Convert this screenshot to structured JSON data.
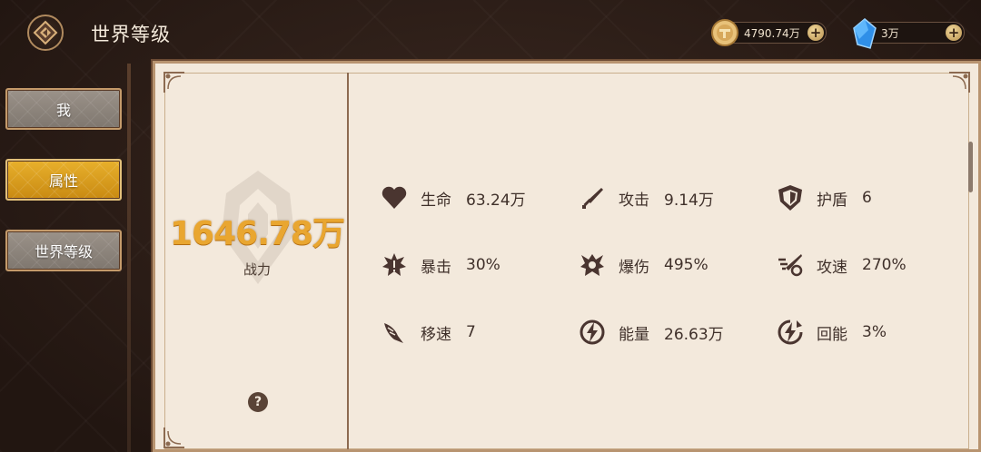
{
  "header": {
    "title": "世界等级",
    "gold_amount": "4790.74万",
    "gem_amount": "3万"
  },
  "tabs": [
    {
      "label": "我",
      "active": false
    },
    {
      "label": "属性",
      "active": true
    },
    {
      "label": "世界等级",
      "active": false
    }
  ],
  "power": {
    "value": "1646.78万",
    "label": "战力"
  },
  "help": {
    "label": "?"
  },
  "stats": [
    {
      "name": "生命",
      "value": "63.24万",
      "icon": "heart-icon"
    },
    {
      "name": "攻击",
      "value": "9.14万",
      "icon": "sword-icon"
    },
    {
      "name": "护盾",
      "value": "6",
      "icon": "shield-icon"
    },
    {
      "name": "暴击",
      "value": "30%",
      "icon": "crit-icon"
    },
    {
      "name": "爆伤",
      "value": "495%",
      "icon": "crit-damage-icon"
    },
    {
      "name": "攻速",
      "value": "270%",
      "icon": "attack-speed-icon"
    },
    {
      "name": "移速",
      "value": "7",
      "icon": "wing-icon"
    },
    {
      "name": "能量",
      "value": "26.63万",
      "icon": "energy-icon"
    },
    {
      "name": "回能",
      "value": "3%",
      "icon": "energy-regen-icon"
    }
  ],
  "colors": {
    "accent_gold": "#e9a630",
    "panel_bg": "#f3e9dc",
    "icon_brown": "#4a3530"
  }
}
